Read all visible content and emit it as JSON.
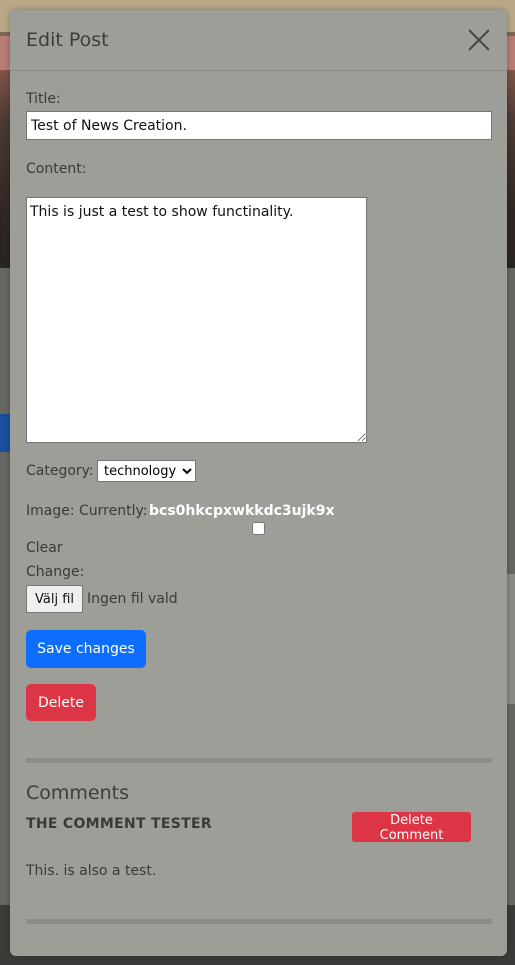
{
  "modal": {
    "title": "Edit Post",
    "title_label": "Title:",
    "title_value": "Test of News Creation.",
    "content_label": "Content:",
    "content_value": "This is just a test to show functinality.",
    "category_label": "Category:",
    "category_selected": "technology",
    "image_label": "Image: Currently:",
    "image_filename": "bcs0hkcpxwkkdc3ujk9x",
    "clear_label": "Clear",
    "change_label": "Change:",
    "file_button_label": "Välj fil",
    "file_status": "Ingen fil vald",
    "save_label": "Save changes",
    "delete_label": "Delete"
  },
  "comments": {
    "heading": "Comments",
    "items": [
      {
        "author": "THE COMMENT TESTER",
        "text": "This. is also a test.",
        "delete_label": "Delete Comment"
      }
    ]
  },
  "colors": {
    "primary": "#0d6efd",
    "danger": "#dc3545",
    "modal_bg": "#9e9e98"
  }
}
